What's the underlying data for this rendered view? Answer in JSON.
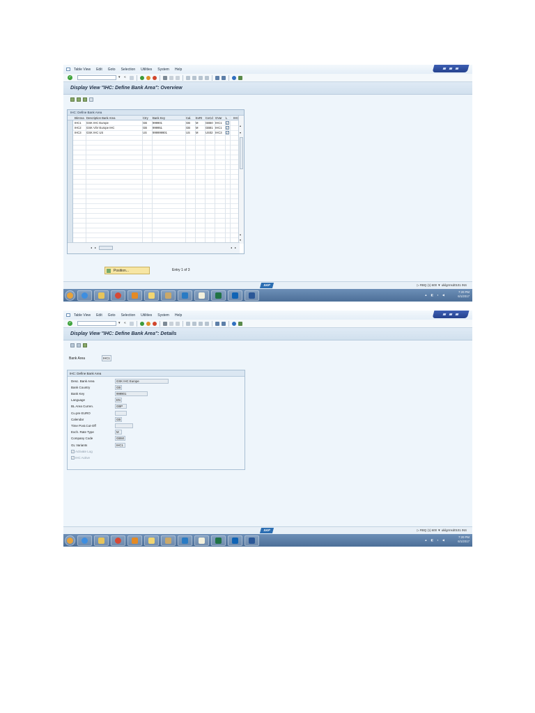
{
  "menu": [
    "Table View",
    "Edit",
    "Goto",
    "Selection",
    "Utilities",
    "System",
    "Help"
  ],
  "overview": {
    "title": "Display View \"IHC: Define Bank Area\": Overview",
    "table_title": "IHC: Define Bank Area",
    "columns": [
      "BkArea",
      "Description Bank Area",
      "Ctry",
      "Bank Key",
      "Cal.",
      "ExRt",
      "CoCd",
      "GVar",
      "L",
      "IHC"
    ],
    "rows": [
      {
        "bkarea": "IHC1",
        "desc": "GSK IHC Europe",
        "ctry": "GB",
        "bankkey": "999901",
        "cal": "GB",
        "exrt": "M",
        "cocd": "GB50",
        "gvar": "IHC1",
        "checked": true
      },
      {
        "bkarea": "IHC2",
        "desc": "GSK ViiV Europe IHC",
        "ctry": "GB",
        "bankkey": "999951",
        "cal": "GB",
        "exrt": "M",
        "cocd": "GB81",
        "gvar": "IHC1",
        "checked": true
      },
      {
        "bkarea": "IHC3",
        "desc": "GSK IHC US",
        "ctry": "US",
        "bankkey": "999999901",
        "cal": "US",
        "exrt": "M",
        "cocd": "US02",
        "gvar": "IHC3",
        "checked": true
      }
    ],
    "position_button": "Position...",
    "entry_text": "Entry 1 of 3"
  },
  "details": {
    "title": "Display View \"IHC: Define Bank Area\": Details",
    "bank_area_label": "Bank Area",
    "bank_area_value": "IHC1",
    "group_title": "IHC: Define Bank Area",
    "fields": [
      {
        "label": "Desc. Bank Area",
        "value": "GSK IHC Europe"
      },
      {
        "label": "Bank Country",
        "value": "GB"
      },
      {
        "label": "Bank Key",
        "value": "999901"
      },
      {
        "label": "Language",
        "value": "EN"
      },
      {
        "label": "BL Area Curren.",
        "value": "GBP"
      },
      {
        "label": "Cu.pre EURO",
        "value": ""
      },
      {
        "label": "Calendar",
        "value": "GB"
      },
      {
        "label": "Time Post.Cut-Off",
        "value": ""
      },
      {
        "label": "Exch. Rate Type",
        "value": "M"
      },
      {
        "label": "Company Code",
        "value": "GB50"
      },
      {
        "label": "GL Variants",
        "value": "IHC1"
      }
    ],
    "checkboxes": [
      "Activate Log",
      "IHC Active"
    ]
  },
  "status": {
    "sap_logo": "SAP",
    "system_info": "▷  RBQ (1) 600 ▼  ukilgrmsd0101  INS",
    "time": "7:20 PM",
    "date": "6/1/2017"
  },
  "colors": {
    "sap_blue": "#2c6eb2",
    "title_bg": "#d1e0ee",
    "taskbar": "#4d6f98",
    "position_button": "#f7e6a3"
  }
}
